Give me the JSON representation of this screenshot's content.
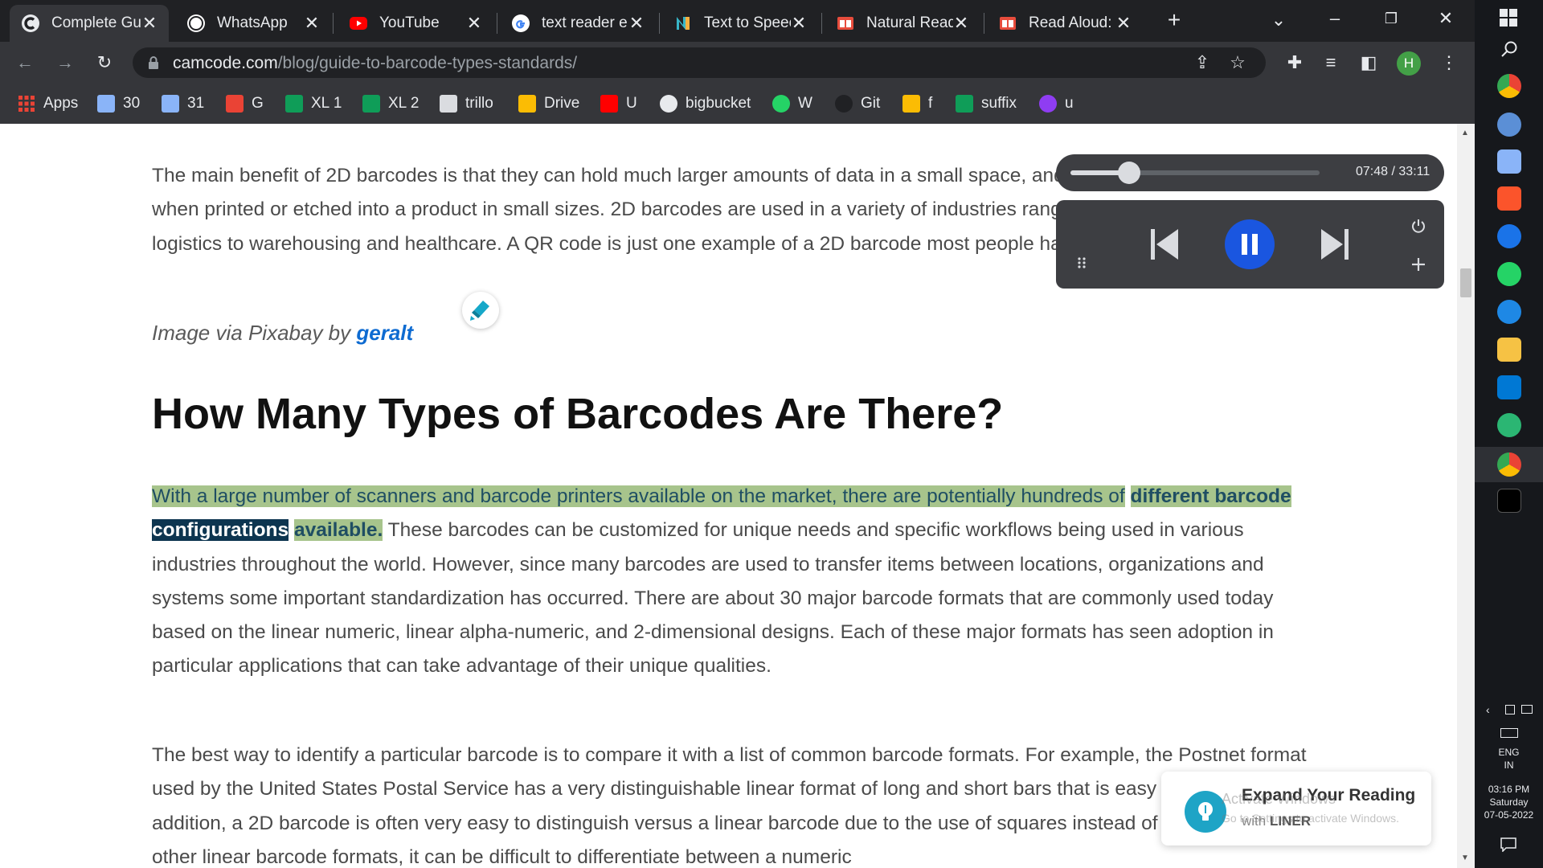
{
  "tabs": [
    {
      "title": "Complete Gu",
      "icon": "camcode-icon",
      "active": true
    },
    {
      "title": "WhatsApp",
      "icon": "whatsapp-icon"
    },
    {
      "title": "YouTube",
      "icon": "youtube-icon"
    },
    {
      "title": "text reader e",
      "icon": "google-icon"
    },
    {
      "title": "Text to Speec",
      "icon": "naturalreader-icon"
    },
    {
      "title": "Natural Read",
      "icon": "readaloud-icon"
    },
    {
      "title": "Read Aloud: ",
      "icon": "readaloud-icon"
    }
  ],
  "address_bar": {
    "host": "camcode.com",
    "path": "/blog/guide-to-barcode-types-standards/"
  },
  "profile_initial": "H",
  "bookmarks": [
    {
      "label": "Apps",
      "icon": "apps-grid-icon",
      "color": "#ea4335"
    },
    {
      "label": "30",
      "icon": "bookmark-icon",
      "color": "#8ab4f8"
    },
    {
      "label": "31",
      "icon": "bookmark-icon",
      "color": "#8ab4f8"
    },
    {
      "label": "G",
      "icon": "gmail-icon",
      "color": "#ea4335"
    },
    {
      "label": "XL 1",
      "icon": "sheets-icon",
      "color": "#0f9d58"
    },
    {
      "label": "XL 2",
      "icon": "sheets-icon",
      "color": "#0f9d58"
    },
    {
      "label": "trillo",
      "icon": "trello-icon",
      "color": "#dadce0"
    },
    {
      "label": "Drive",
      "icon": "drive-icon",
      "color": "#fbbc04"
    },
    {
      "label": "U",
      "icon": "youtube-icon",
      "color": "#ff0000"
    },
    {
      "label": "bigbucket",
      "icon": "globe-icon",
      "color": "#e8eaed"
    },
    {
      "label": "W",
      "icon": "whatsapp-icon",
      "color": "#25d366"
    },
    {
      "label": "Git",
      "icon": "github-icon",
      "color": "#202124"
    },
    {
      "label": "f",
      "icon": "keep-icon",
      "color": "#fbbc04"
    },
    {
      "label": "suffix",
      "icon": "sheets-icon",
      "color": "#0f9d58"
    },
    {
      "label": "u",
      "icon": "bookmark-purple-icon",
      "color": "#8f3df2"
    }
  ],
  "article": {
    "para1": "The main benefit of 2D barcodes is that they can hold much larger amounts of data in a small space, and they remain legible even when printed or etched into a product in small sizes. 2D barcodes are used in a variety of industries ranging from manufacturing and logistics to warehousing and healthcare. A QR code is just one example of a 2D barcode most people have encountered.",
    "caption_prefix": "Image via Pixabay by ",
    "caption_author": "geralt",
    "heading": "How Many Types of Barcodes Are There?",
    "para2_hl_1": "With a large number of scanners and barcode printers available on the market, there are potentially hundreds of",
    "para2_hl_2": "different barcode",
    "para2_hl_current": "configurations",
    "para2_hl_3": "available.",
    "para2_rest": "These barcodes can be customized for unique needs and specific workflows being used in various industries throughout the world. However, since many barcodes are used to transfer items between locations, organizations and systems some important standardization has occurred. There are about 30 major barcode formats that are commonly used today based on the linear numeric, linear alpha-numeric, and 2-dimensional designs. Each of these major formats has seen adoption in particular applications that can take advantage of their unique qualities.",
    "para3": "The best way to identify a particular barcode is to compare it with a list of common barcode formats. For example, the Postnet format used by the United States Postal Service has a very distinguishable linear format of long and short bars that is easy to identify. In addition, a 2D barcode is often very easy to distinguish versus a linear barcode due to the use of squares instead of lines. With many other linear barcode formats, it can be difficult to differentiate between a numeric"
  },
  "reader": {
    "elapsed": "07:48",
    "total": "33:11",
    "progress": 0.235,
    "state": "playing"
  },
  "toast": {
    "title": "Expand Your Reading",
    "sub_prefix": "with ",
    "brand": "LINER"
  },
  "watermark": {
    "title": "Activate Windows",
    "sub": "Go to Settings to activate Windows."
  },
  "system_tray": {
    "language": "ENG",
    "region": "IN",
    "time": "03:16 PM",
    "day": "Saturday",
    "date": "07-05-2022"
  }
}
